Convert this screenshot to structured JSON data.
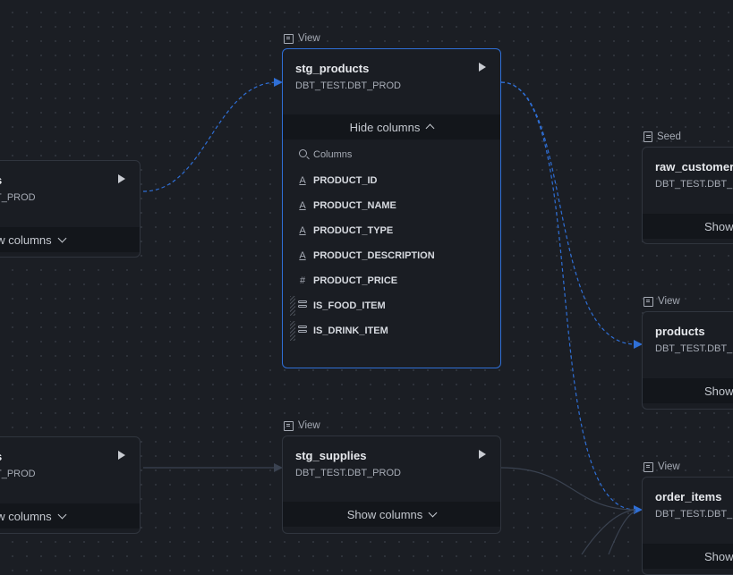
{
  "nodes": {
    "left_top": {
      "title": "s",
      "subtitle": "T_PROD",
      "toggle": "ow columns"
    },
    "left_bottom": {
      "title": "s",
      "subtitle": "T_PROD",
      "toggle": "ow columns"
    },
    "stg_products": {
      "type": "View",
      "title": "stg_products",
      "subtitle": "DBT_TEST.DBT_PROD",
      "toggle": "Hide columns",
      "search_label": "Columns",
      "columns": [
        {
          "name": "PRODUCT_ID",
          "icon": "text-type-icon"
        },
        {
          "name": "PRODUCT_NAME",
          "icon": "text-type-icon"
        },
        {
          "name": "PRODUCT_TYPE",
          "icon": "text-type-icon"
        },
        {
          "name": "PRODUCT_DESCRIPTION",
          "icon": "text-type-icon"
        },
        {
          "name": "PRODUCT_PRICE",
          "icon": "number-type-icon"
        },
        {
          "name": "IS_FOOD_ITEM",
          "icon": "boolean-type-icon"
        },
        {
          "name": "IS_DRINK_ITEM",
          "icon": "boolean-type-icon"
        }
      ]
    },
    "stg_supplies": {
      "type": "View",
      "title": "stg_supplies",
      "subtitle": "DBT_TEST.DBT_PROD",
      "toggle": "Show columns"
    },
    "raw_customers": {
      "type": "Seed",
      "title": "raw_customers",
      "subtitle": "DBT_TEST.DBT_PR",
      "toggle": "Show"
    },
    "products": {
      "type": "View",
      "title": "products",
      "subtitle": "DBT_TEST.DBT_PR",
      "toggle": "Show"
    },
    "order_items": {
      "type": "View",
      "title": "order_items",
      "subtitle": "DBT_TEST.DBT_PR",
      "toggle": "Show"
    }
  },
  "colors": {
    "accent": "#2f6fd6",
    "background": "#1b1e24",
    "node": "#1a1d23",
    "edge": "#3a4250"
  }
}
